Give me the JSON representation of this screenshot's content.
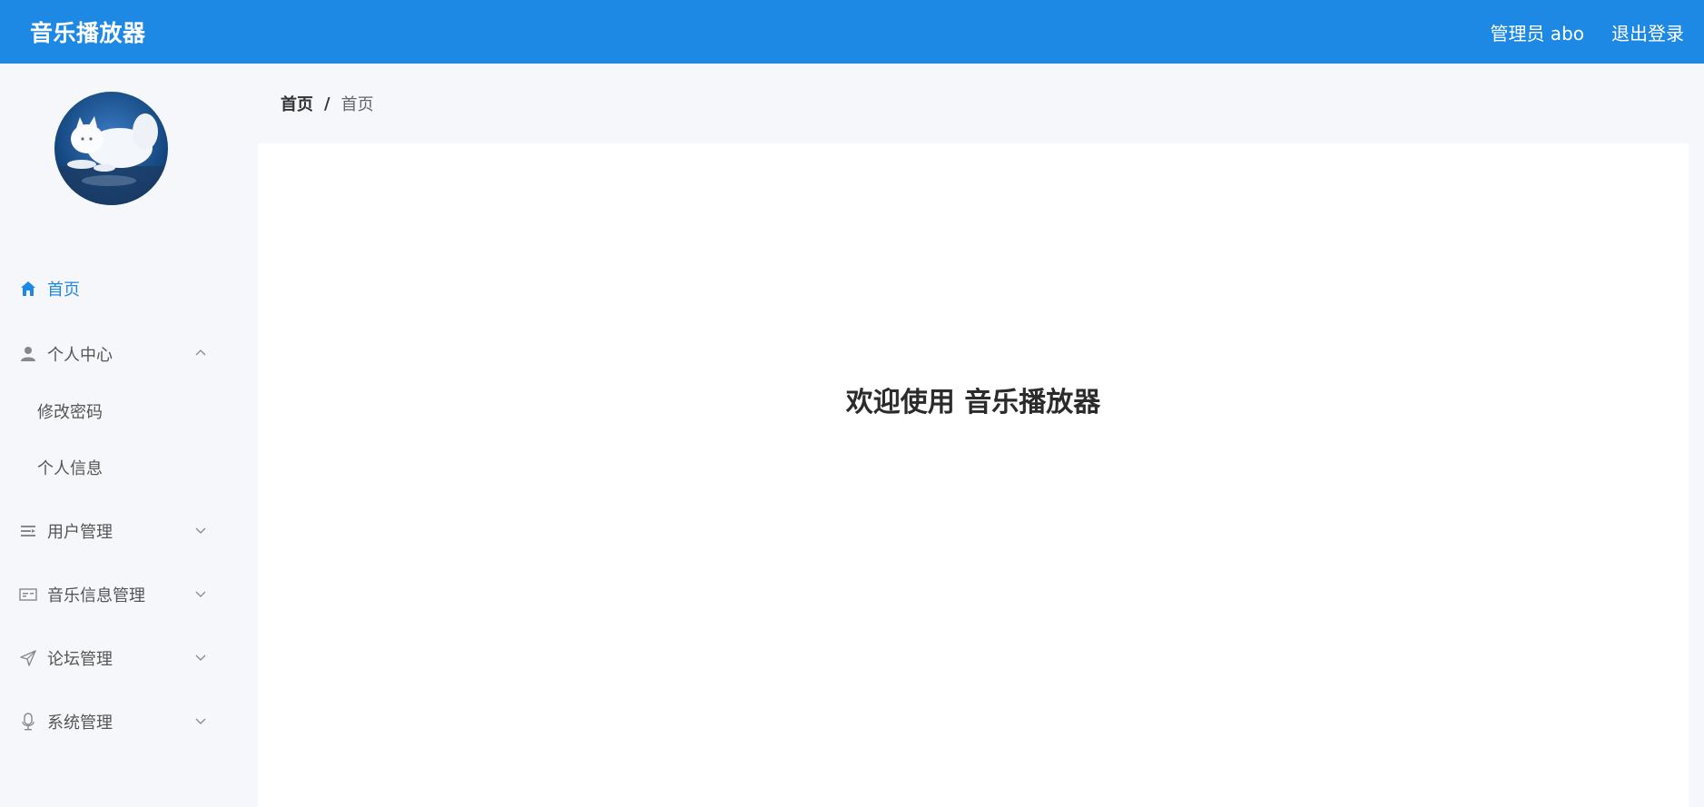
{
  "header": {
    "brand": "音乐播放器",
    "user_label": "管理员 abo",
    "logout_label": "退出登录",
    "background_color": "#1e88e5"
  },
  "sidebar": {
    "avatar_icon": "cat-avatar-image",
    "items": [
      {
        "label": "首页",
        "icon": "home-icon",
        "active": true
      },
      {
        "label": "个人中心",
        "icon": "user-icon",
        "expanded": true,
        "children": [
          {
            "label": "修改密码"
          },
          {
            "label": "个人信息"
          }
        ]
      },
      {
        "label": "用户管理",
        "icon": "list-icon",
        "expanded": false
      },
      {
        "label": "音乐信息管理",
        "icon": "card-icon",
        "expanded": false
      },
      {
        "label": "论坛管理",
        "icon": "send-icon",
        "expanded": false
      },
      {
        "label": "系统管理",
        "icon": "microphone-icon",
        "expanded": false
      }
    ],
    "active_color": "#1e88e5"
  },
  "breadcrumb": {
    "first": "首页",
    "separator": "/",
    "second": "首页"
  },
  "main": {
    "welcome": "欢迎使用 音乐播放器"
  }
}
